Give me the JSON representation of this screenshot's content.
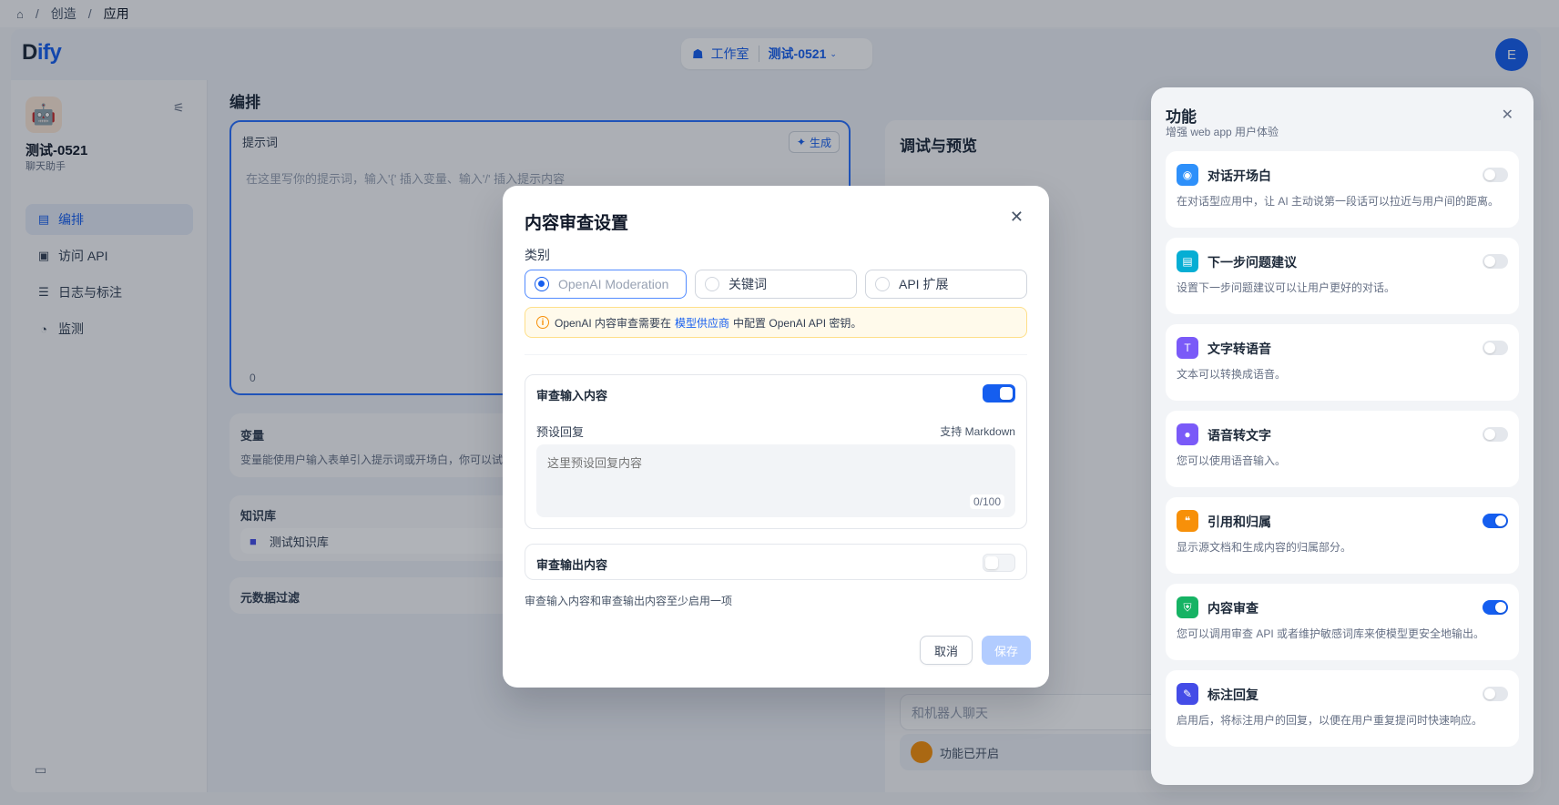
{
  "breadcrumb": {
    "home_icon": "home-icon",
    "sep": "/",
    "items": [
      "创造",
      "应用"
    ]
  },
  "header": {
    "logo_a": "D",
    "logo_b": "ify",
    "workspace_label": "工作室",
    "app_label": "测试-0521",
    "user_initial": "E"
  },
  "sidebar": {
    "app_name": "测试-0521",
    "app_type": "聊天助手",
    "items": [
      {
        "label": "编排",
        "icon": "layout-icon",
        "active": true
      },
      {
        "label": "访问 API",
        "icon": "terminal-icon"
      },
      {
        "label": "日志与标注",
        "icon": "file-list-icon"
      },
      {
        "label": "监测",
        "icon": "gauge-icon"
      }
    ]
  },
  "main": {
    "title": "编排",
    "prompt": {
      "label": "提示词",
      "generate": "生成",
      "placeholder": "在这里写你的提示词，输入'{' 插入变量、输入'/' 插入提示内容",
      "count": "0"
    },
    "variables": {
      "title": "变量",
      "desc": "变量能使用户输入表单引入提示词或开场白，你可以试试"
    },
    "knowledge": {
      "title": "知识库",
      "item": "测试知识库"
    },
    "metadata": {
      "title": "元数据过滤"
    }
  },
  "debug": {
    "title": "调试与预览",
    "chat_placeholder": "和机器人聊天",
    "features_enabled": "功能已开启"
  },
  "features_panel": {
    "title": "功能",
    "subtitle": "增强 web app 用户体验",
    "items": [
      {
        "name": "对话开场白",
        "desc": "在对话型应用中，让 AI 主动说第一段话可以拉近与用户间的距离。",
        "enabled": false,
        "color": "#2e90fa"
      },
      {
        "name": "下一步问题建议",
        "desc": "设置下一步问题建议可以让用户更好的对话。",
        "enabled": false,
        "color": "#06aed4"
      },
      {
        "name": "文字转语音",
        "desc": "文本可以转换成语音。",
        "enabled": false,
        "color": "#7a5af8"
      },
      {
        "name": "语音转文字",
        "desc": "您可以使用语音输入。",
        "enabled": false,
        "color": "#7a5af8"
      },
      {
        "name": "引用和归属",
        "desc": "显示源文档和生成内容的归属部分。",
        "enabled": true,
        "color": "#f79009"
      },
      {
        "name": "内容审查",
        "desc": "您可以调用审查 API 或者维护敏感词库来使模型更安全地输出。",
        "enabled": true,
        "color": "#16b364"
      },
      {
        "name": "标注回复",
        "desc": "启用后，将标注用户的回复，以便在用户重复提问时快速响应。",
        "enabled": false,
        "color": "#444ce7"
      }
    ]
  },
  "modal": {
    "title": "内容审查设置",
    "category_label": "类别",
    "options": [
      "OpenAI Moderation",
      "关键词",
      "API 扩展"
    ],
    "warning_pre": "OpenAI 内容审查需要在",
    "warning_link": "模型供应商",
    "warning_post": "中配置 OpenAI API 密钥。",
    "input_section": {
      "label": "审查输入内容",
      "enabled": true,
      "preset_label": "预设回复",
      "markdown_hint": "支持 Markdown",
      "placeholder": "这里预设回复内容",
      "count": "0/100"
    },
    "output_section": {
      "label": "审查输出内容",
      "enabled": false
    },
    "hint": "审查输入内容和审查输出内容至少启用一项",
    "cancel": "取消",
    "save": "保存"
  }
}
